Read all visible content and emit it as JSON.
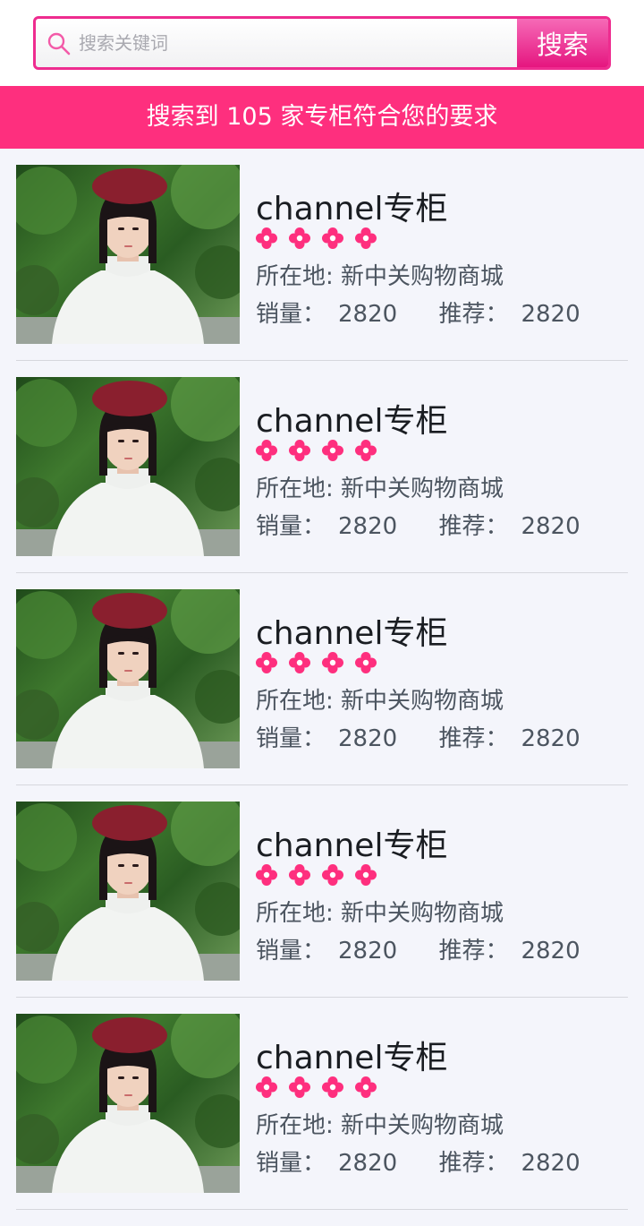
{
  "search": {
    "placeholder": "搜索关键词",
    "button_label": "搜索"
  },
  "banner": {
    "text": "搜索到 105 家专柜符合您的要求"
  },
  "colors": {
    "accent": "#fe2f7e",
    "search_border": "#ee2c8f",
    "rating_icon": "#fe2f7e"
  },
  "shops": [
    {
      "name": "channel专柜",
      "rating_icon": "flower-icon",
      "rating": 4,
      "location_label": "所在地:",
      "location": "新中关购物商城",
      "sales_label": "销量：",
      "sales": "2820",
      "recommend_label": "推荐：",
      "recommend": "2820"
    },
    {
      "name": "channel专柜",
      "rating_icon": "flower-icon",
      "rating": 4,
      "location_label": "所在地:",
      "location": "新中关购物商城",
      "sales_label": "销量：",
      "sales": "2820",
      "recommend_label": "推荐：",
      "recommend": "2820"
    },
    {
      "name": "channel专柜",
      "rating_icon": "flower-icon",
      "rating": 4,
      "location_label": "所在地:",
      "location": "新中关购物商城",
      "sales_label": "销量：",
      "sales": "2820",
      "recommend_label": "推荐：",
      "recommend": "2820"
    },
    {
      "name": "channel专柜",
      "rating_icon": "flower-icon",
      "rating": 4,
      "location_label": "所在地:",
      "location": "新中关购物商城",
      "sales_label": "销量：",
      "sales": "2820",
      "recommend_label": "推荐：",
      "recommend": "2820"
    },
    {
      "name": "channel专柜",
      "rating_icon": "flower-icon",
      "rating": 4,
      "location_label": "所在地:",
      "location": "新中关购物商城",
      "sales_label": "销量：",
      "sales": "2820",
      "recommend_label": "推荐：",
      "recommend": "2820"
    }
  ]
}
